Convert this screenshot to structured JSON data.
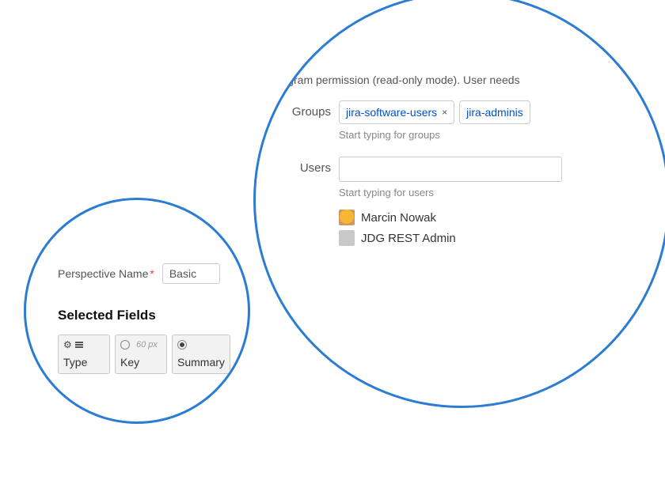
{
  "permissions": {
    "description": "program permission (read-only mode). User needs",
    "groups": {
      "label": "Groups",
      "hint": "Start typing for groups",
      "tag1": "jira-software-users",
      "tag2": "jira-adminis"
    },
    "users": {
      "label": "Users",
      "hint": "Start typing for users",
      "list": {
        "u1": "Marcin Nowak",
        "u2": "JDG REST Admin"
      }
    }
  },
  "perspective": {
    "name_label": "Perspective Name",
    "required": "*",
    "name_value": "Basic",
    "selected_fields_title": "Selected Fields",
    "fields": {
      "f1": "Type",
      "f2": "Key",
      "f2_px": "60 px",
      "f3": "Summary"
    }
  }
}
